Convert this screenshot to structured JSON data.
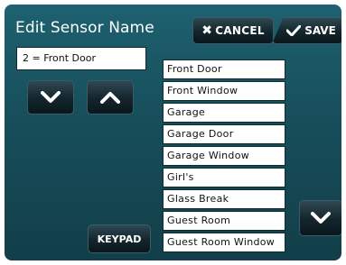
{
  "header": {
    "title": "Edit Sensor Name",
    "cancel_label": "CANCEL",
    "save_label": "SAVE"
  },
  "current_name": "2 = Front Door",
  "keypad_label": "KEYPAD",
  "name_list": [
    "Front Door",
    "Front Window",
    "Garage",
    "Garage Door",
    "Garage Window",
    "Girl's",
    "Glass Break",
    "Guest Room",
    "Guest Room Window"
  ],
  "icons": {
    "cancel": "x-icon",
    "save": "check-icon",
    "scroll_down": "chevron-down-icon",
    "scroll_up": "chevron-up-icon"
  }
}
